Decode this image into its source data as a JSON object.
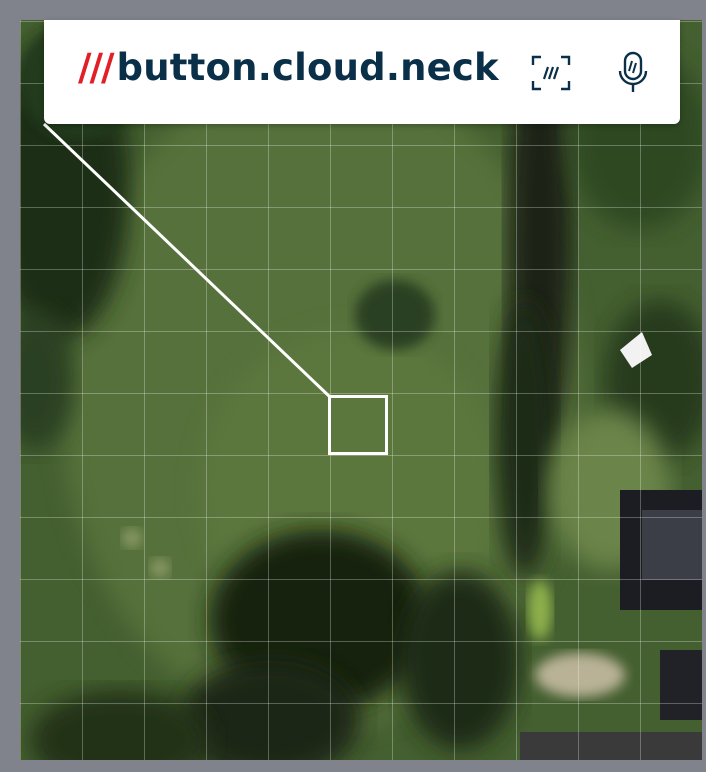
{
  "address": {
    "prefix": "///",
    "words": "button.cloud.neck"
  },
  "toolbar": {
    "scan_icon": "scan-3wa-icon",
    "mic_icon": "microphone-icon"
  },
  "map": {
    "view": "satellite",
    "grid": true,
    "selected_square": true
  },
  "colors": {
    "brand_red": "#e11f26",
    "brand_navy": "#0a3049"
  }
}
